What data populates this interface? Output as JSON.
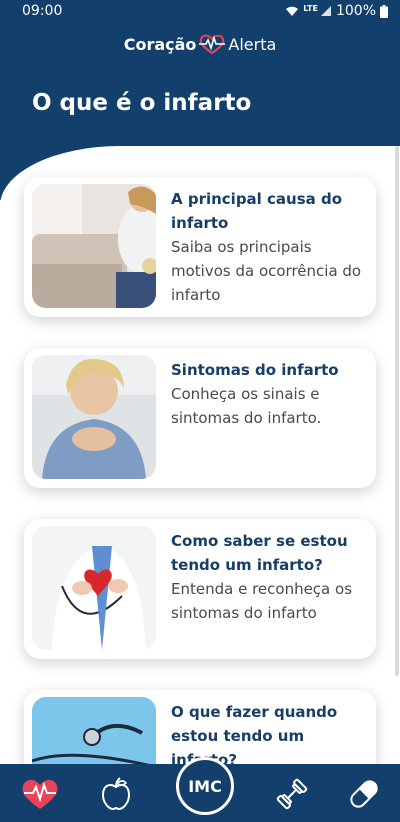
{
  "status_bar": {
    "time": "09:00",
    "network": "LTE",
    "battery": "100%"
  },
  "brand": {
    "part1": "Coração",
    "part2": "Alerta"
  },
  "page": {
    "title": "O que é o infarto"
  },
  "cards": [
    {
      "title": "A principal causa do infarto",
      "description": "Saiba os principais motivos da ocorrência do infarto"
    },
    {
      "title": "Sintomas do infarto",
      "description": "Conheça os sinais e sintomas do infarto."
    },
    {
      "title": "Como saber se estou tendo um infarto?",
      "description": "Entenda e reconheça os sintomas do infarto"
    },
    {
      "title": "O que fazer quando estou tendo um infarto?",
      "description": ""
    }
  ],
  "bottom_nav": {
    "center_label": "IMC"
  },
  "colors": {
    "primary": "#123f6b",
    "accent": "#e8435a",
    "card_title": "#173e66"
  }
}
